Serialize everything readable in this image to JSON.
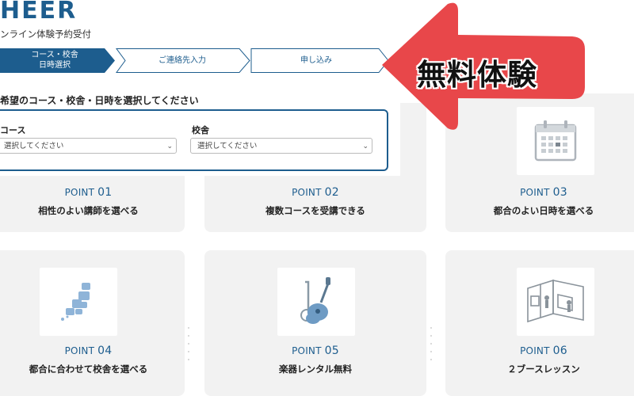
{
  "header": {
    "logo": "HEER",
    "subtitle": "ンライン体験予約受付"
  },
  "steps": [
    {
      "line1": "コース・校舎",
      "line2": "日時選択"
    },
    {
      "line1": "ご連絡先入力",
      "line2": ""
    },
    {
      "line1": "申し込み",
      "line2": ""
    }
  ],
  "form": {
    "title": "希望のコース・校舎・日時を選択してください",
    "course_label": "コース",
    "course_value": "選択してください",
    "school_label": "校舎",
    "school_value": "選択してください"
  },
  "overlay": {
    "text": "無料体験",
    "arrow_color": "#e8474a"
  },
  "points": [
    {
      "prefix": "POINT",
      "num": "01",
      "text": "相性のよい講師を選べる",
      "icon": "teacher-image"
    },
    {
      "prefix": "POINT",
      "num": "02",
      "text": "複数コースを受講できる",
      "icon": "courses-image"
    },
    {
      "prefix": "POINT",
      "num": "03",
      "text": "都合のよい日時を選べる",
      "icon": "calendar-icon"
    },
    {
      "prefix": "POINT",
      "num": "04",
      "text": "都合に合わせて校舎を選べる",
      "icon": "japan-map-icon"
    },
    {
      "prefix": "POINT",
      "num": "05",
      "text": "楽器レンタル無料",
      "icon": "instruments-icon"
    },
    {
      "prefix": "POINT",
      "num": "06",
      "text": "２ブースレッスン",
      "icon": "booth-room-icon"
    }
  ],
  "colors": {
    "brand": "#1d5d8e",
    "card_bg": "#f2f2f2"
  }
}
